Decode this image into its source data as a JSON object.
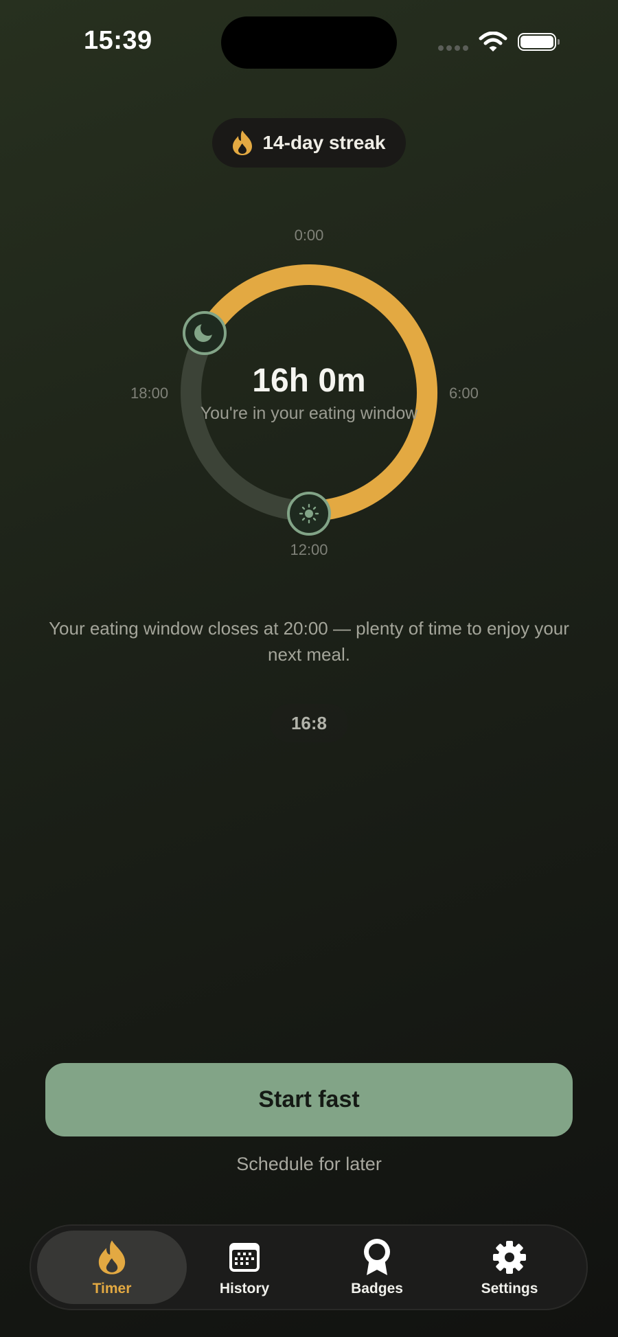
{
  "status_bar": {
    "time": "15:39"
  },
  "streak": {
    "label": "14-day streak"
  },
  "dial": {
    "labels": {
      "top": "0:00",
      "right": "6:00",
      "bottom": "12:00",
      "left": "18:00"
    },
    "elapsed": "16h 0m",
    "status": "You're in your eating window",
    "fasting_fraction": 0.667
  },
  "message": "Your eating window closes at 20:00 — plenty of time to enjoy your next meal.",
  "plan_badge": "16:8",
  "actions": {
    "start": "Start fast",
    "schedule": "Schedule for later"
  },
  "tabs": [
    {
      "label": "Timer",
      "icon": "flame-icon",
      "active": true
    },
    {
      "label": "History",
      "icon": "calendar-icon",
      "active": false
    },
    {
      "label": "Badges",
      "icon": "badge-icon",
      "active": false
    },
    {
      "label": "Settings",
      "icon": "gear-icon",
      "active": false
    }
  ],
  "colors": {
    "accent": "#E3A942",
    "primary_green": "#82A487",
    "track": "#3C4337"
  }
}
